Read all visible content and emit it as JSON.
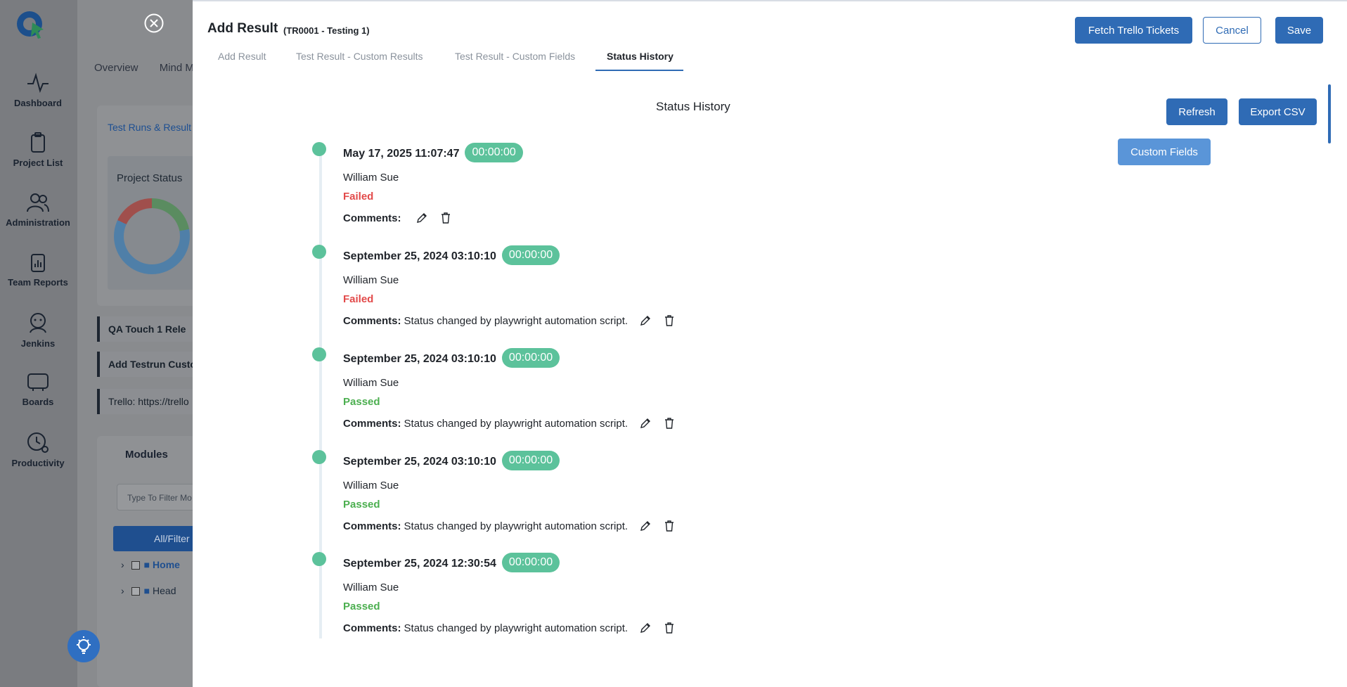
{
  "sidebar": {
    "items": [
      {
        "label": "Dashboard",
        "icon": "pulse-icon"
      },
      {
        "label": "Project List",
        "icon": "clipboard-icon"
      },
      {
        "label": "Administration",
        "icon": "users-icon"
      },
      {
        "label": "Team Reports",
        "icon": "report-icon"
      },
      {
        "label": "Jenkins",
        "icon": "jenkins-icon"
      },
      {
        "label": "Boards",
        "icon": "board-icon"
      },
      {
        "label": "Productivity",
        "icon": "clock-gear-icon"
      }
    ]
  },
  "background": {
    "tabs": [
      "Overview",
      "Mind M"
    ],
    "breadcrumb": "Test Runs & Result",
    "project_status_title": "Project Status",
    "rows": [
      "QA Touch 1      Rele",
      "Add Testrun Custo",
      "Trello: https://trello"
    ],
    "modules_title": "Modules",
    "filter_placeholder": "Type To Filter Mo",
    "all_filter": "All/Filter",
    "tree": [
      "Home",
      "Head"
    ]
  },
  "modal": {
    "title": "Add Result",
    "subtitle": "(TR0001 - Testing 1)",
    "buttons": {
      "fetch_trello": "Fetch Trello Tickets",
      "cancel": "Cancel",
      "save": "Save",
      "refresh": "Refresh",
      "export_csv": "Export CSV",
      "custom_fields": "Custom Fields"
    },
    "tabs": [
      "Add Result",
      "Test Result - Custom Results",
      "Test Result - Custom Fields",
      "Status History"
    ],
    "active_tab": "Status History",
    "section_title": "Status History",
    "comments_label": "Comments:",
    "history": [
      {
        "date": "May 17, 2025 11:07:47",
        "duration": "00:00:00",
        "user": "William Sue",
        "status": "Failed",
        "comment": ""
      },
      {
        "date": "September 25, 2024 03:10:10",
        "duration": "00:00:00",
        "user": "William Sue",
        "status": "Failed",
        "comment": "Status changed by playwright automation script."
      },
      {
        "date": "September 25, 2024 03:10:10",
        "duration": "00:00:00",
        "user": "William Sue",
        "status": "Passed",
        "comment": "Status changed by playwright automation script."
      },
      {
        "date": "September 25, 2024 03:10:10",
        "duration": "00:00:00",
        "user": "William Sue",
        "status": "Passed",
        "comment": "Status changed by playwright automation script."
      },
      {
        "date": "September 25, 2024 12:30:54",
        "duration": "00:00:00",
        "user": "William Sue",
        "status": "Passed",
        "comment": "Status changed by playwright automation script."
      }
    ]
  },
  "colors": {
    "primary": "#2f6bb5",
    "badge": "#5cc29b",
    "failed": "#e24a4a",
    "passed": "#4caf50"
  }
}
